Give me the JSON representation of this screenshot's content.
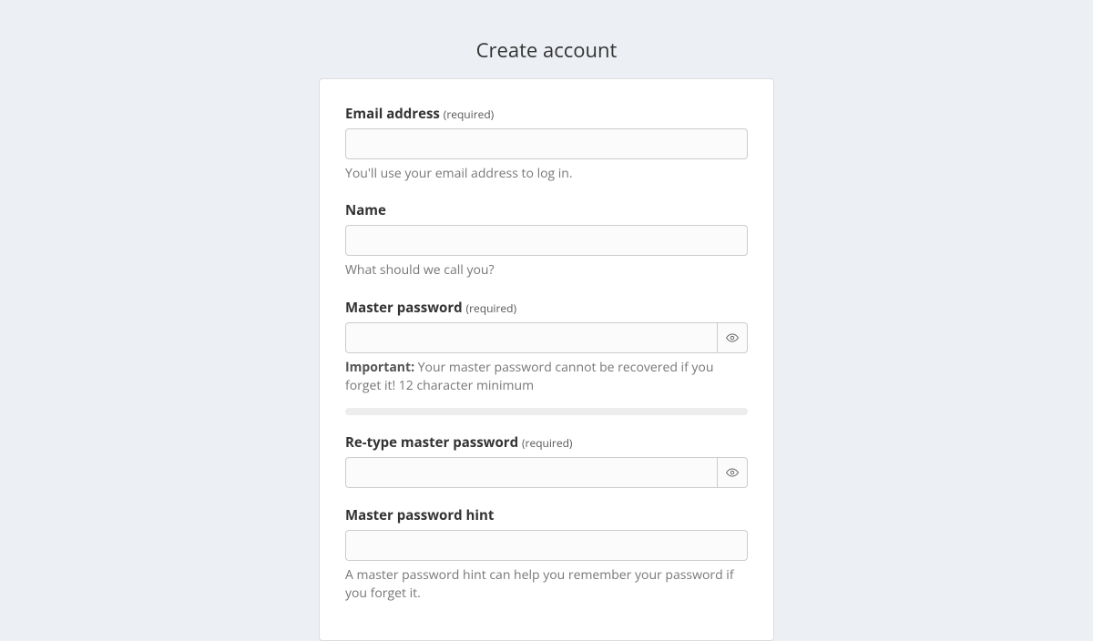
{
  "page": {
    "title": "Create account"
  },
  "labels": {
    "required": "(required)",
    "important": "Important:"
  },
  "fields": {
    "email": {
      "label": "Email address",
      "hint": "You'll use your email address to log in.",
      "value": ""
    },
    "name": {
      "label": "Name",
      "hint": "What should we call you?",
      "value": ""
    },
    "masterPassword": {
      "label": "Master password",
      "hint": " Your master password cannot be recovered if you forget it! 12 character minimum",
      "value": ""
    },
    "retypePassword": {
      "label": "Re-type master password",
      "value": ""
    },
    "passwordHint": {
      "label": "Master password hint",
      "hint": "A master password hint can help you remember your password if you forget it.",
      "value": ""
    }
  }
}
